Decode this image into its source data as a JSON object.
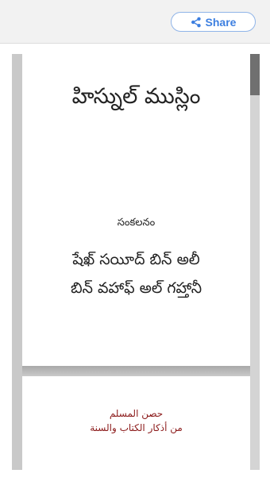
{
  "toolbar": {
    "share_label": "Share",
    "share_icon": "share-icon",
    "accent_color": "#3d7fe0"
  },
  "document": {
    "title": "హిస్నుల్ ముస్లిం",
    "compiled_by_label": "సంకలనం",
    "author_line1": "షేఖ్ సయీద్ బిన్ అలీ",
    "author_line2": "బిన్ వహాఫ్ అల్ గహ్తానీ",
    "arabic_title": "حصن المسلم",
    "arabic_subtitle": "من أذكار الكتاب والسنة",
    "arabic_text_color": "#8b1a1a"
  },
  "scrollbar": {
    "position_fraction": 0
  }
}
